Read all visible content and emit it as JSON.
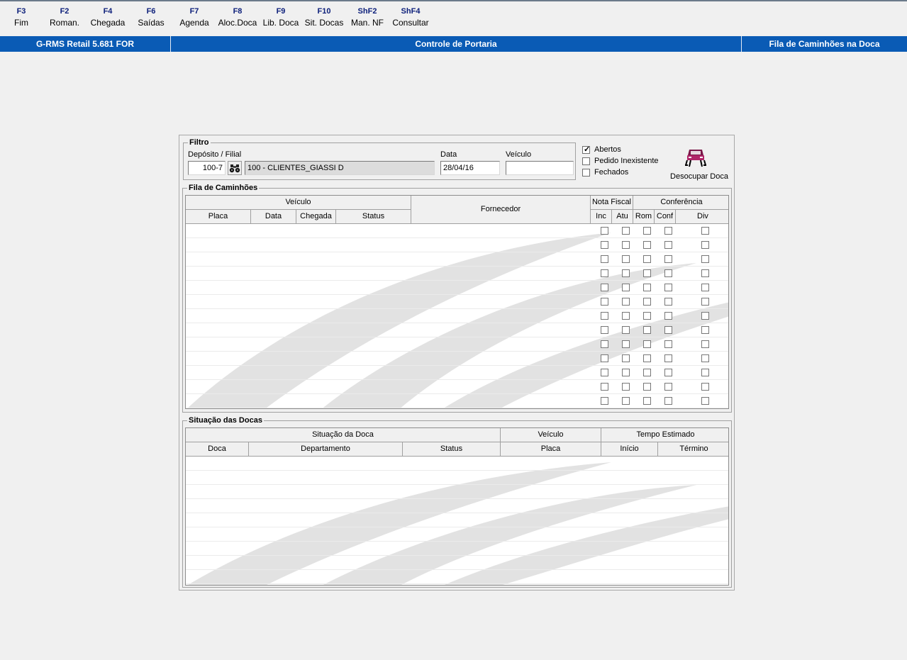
{
  "fkeys": [
    {
      "key": "F3",
      "label": "Fim"
    },
    {
      "key": "F2",
      "label": "Roman."
    },
    {
      "key": "F4",
      "label": "Chegada"
    },
    {
      "key": "F6",
      "label": "Saídas"
    },
    {
      "key": "F7",
      "label": "Agenda"
    },
    {
      "key": "F8",
      "label": "Aloc.Doca"
    },
    {
      "key": "F9",
      "label": "Lib. Doca"
    },
    {
      "key": "F10",
      "label": "Sit. Docas"
    },
    {
      "key": "ShF2",
      "label": "Man. NF"
    },
    {
      "key": "ShF4",
      "label": "Consultar"
    }
  ],
  "titlebar": {
    "app": "G-RMS Retail 5.681 FOR",
    "module": "Controle de Portaria",
    "screen": "Fila de Caminhões na Doca"
  },
  "colors": {
    "titlebar": "#0a5bb5",
    "fkey_text": "#0b1e7a",
    "background": "#f0f0f0"
  },
  "filtro": {
    "title": "Filtro",
    "deposito_label": "Depósito / Filial",
    "deposito_value": "100-7",
    "deposito_icon": "binoculars-icon",
    "deposito_desc": "100 - CLIENTES_GIASSI D",
    "data_label": "Data",
    "data_value": "28/04/16",
    "veiculo_label": "Veículo",
    "veiculo_value": ""
  },
  "options": [
    {
      "label": "Abertos",
      "checked": true
    },
    {
      "label": "Pedido Inexistente",
      "checked": false
    },
    {
      "label": "Fechados",
      "checked": false
    }
  ],
  "desocupar": {
    "label": "Desocupar Doca",
    "icon": "truck-icon"
  },
  "fila": {
    "title": "Fila de Caminhões",
    "group_headers": {
      "veiculo": "Veículo",
      "fornecedor": "Fornecedor",
      "nota_fiscal": "Nota Fiscal",
      "conferencia": "Conferência"
    },
    "columns": {
      "placa": "Placa",
      "data": "Data",
      "chegada": "Chegada",
      "status": "Status",
      "inc": "Inc",
      "atu": "Atu",
      "rom": "Rom",
      "conf": "Conf",
      "div": "Div"
    },
    "rows": 13
  },
  "docas": {
    "title": "Situação das Docas",
    "group_headers": {
      "situacao": "Situação da Doca",
      "veiculo": "Veículo",
      "tempo": "Tempo Estimado"
    },
    "columns": {
      "doca": "Doca",
      "departamento": "Departamento",
      "status": "Status",
      "placa": "Placa",
      "inicio": "Início",
      "termino": "Término"
    }
  }
}
